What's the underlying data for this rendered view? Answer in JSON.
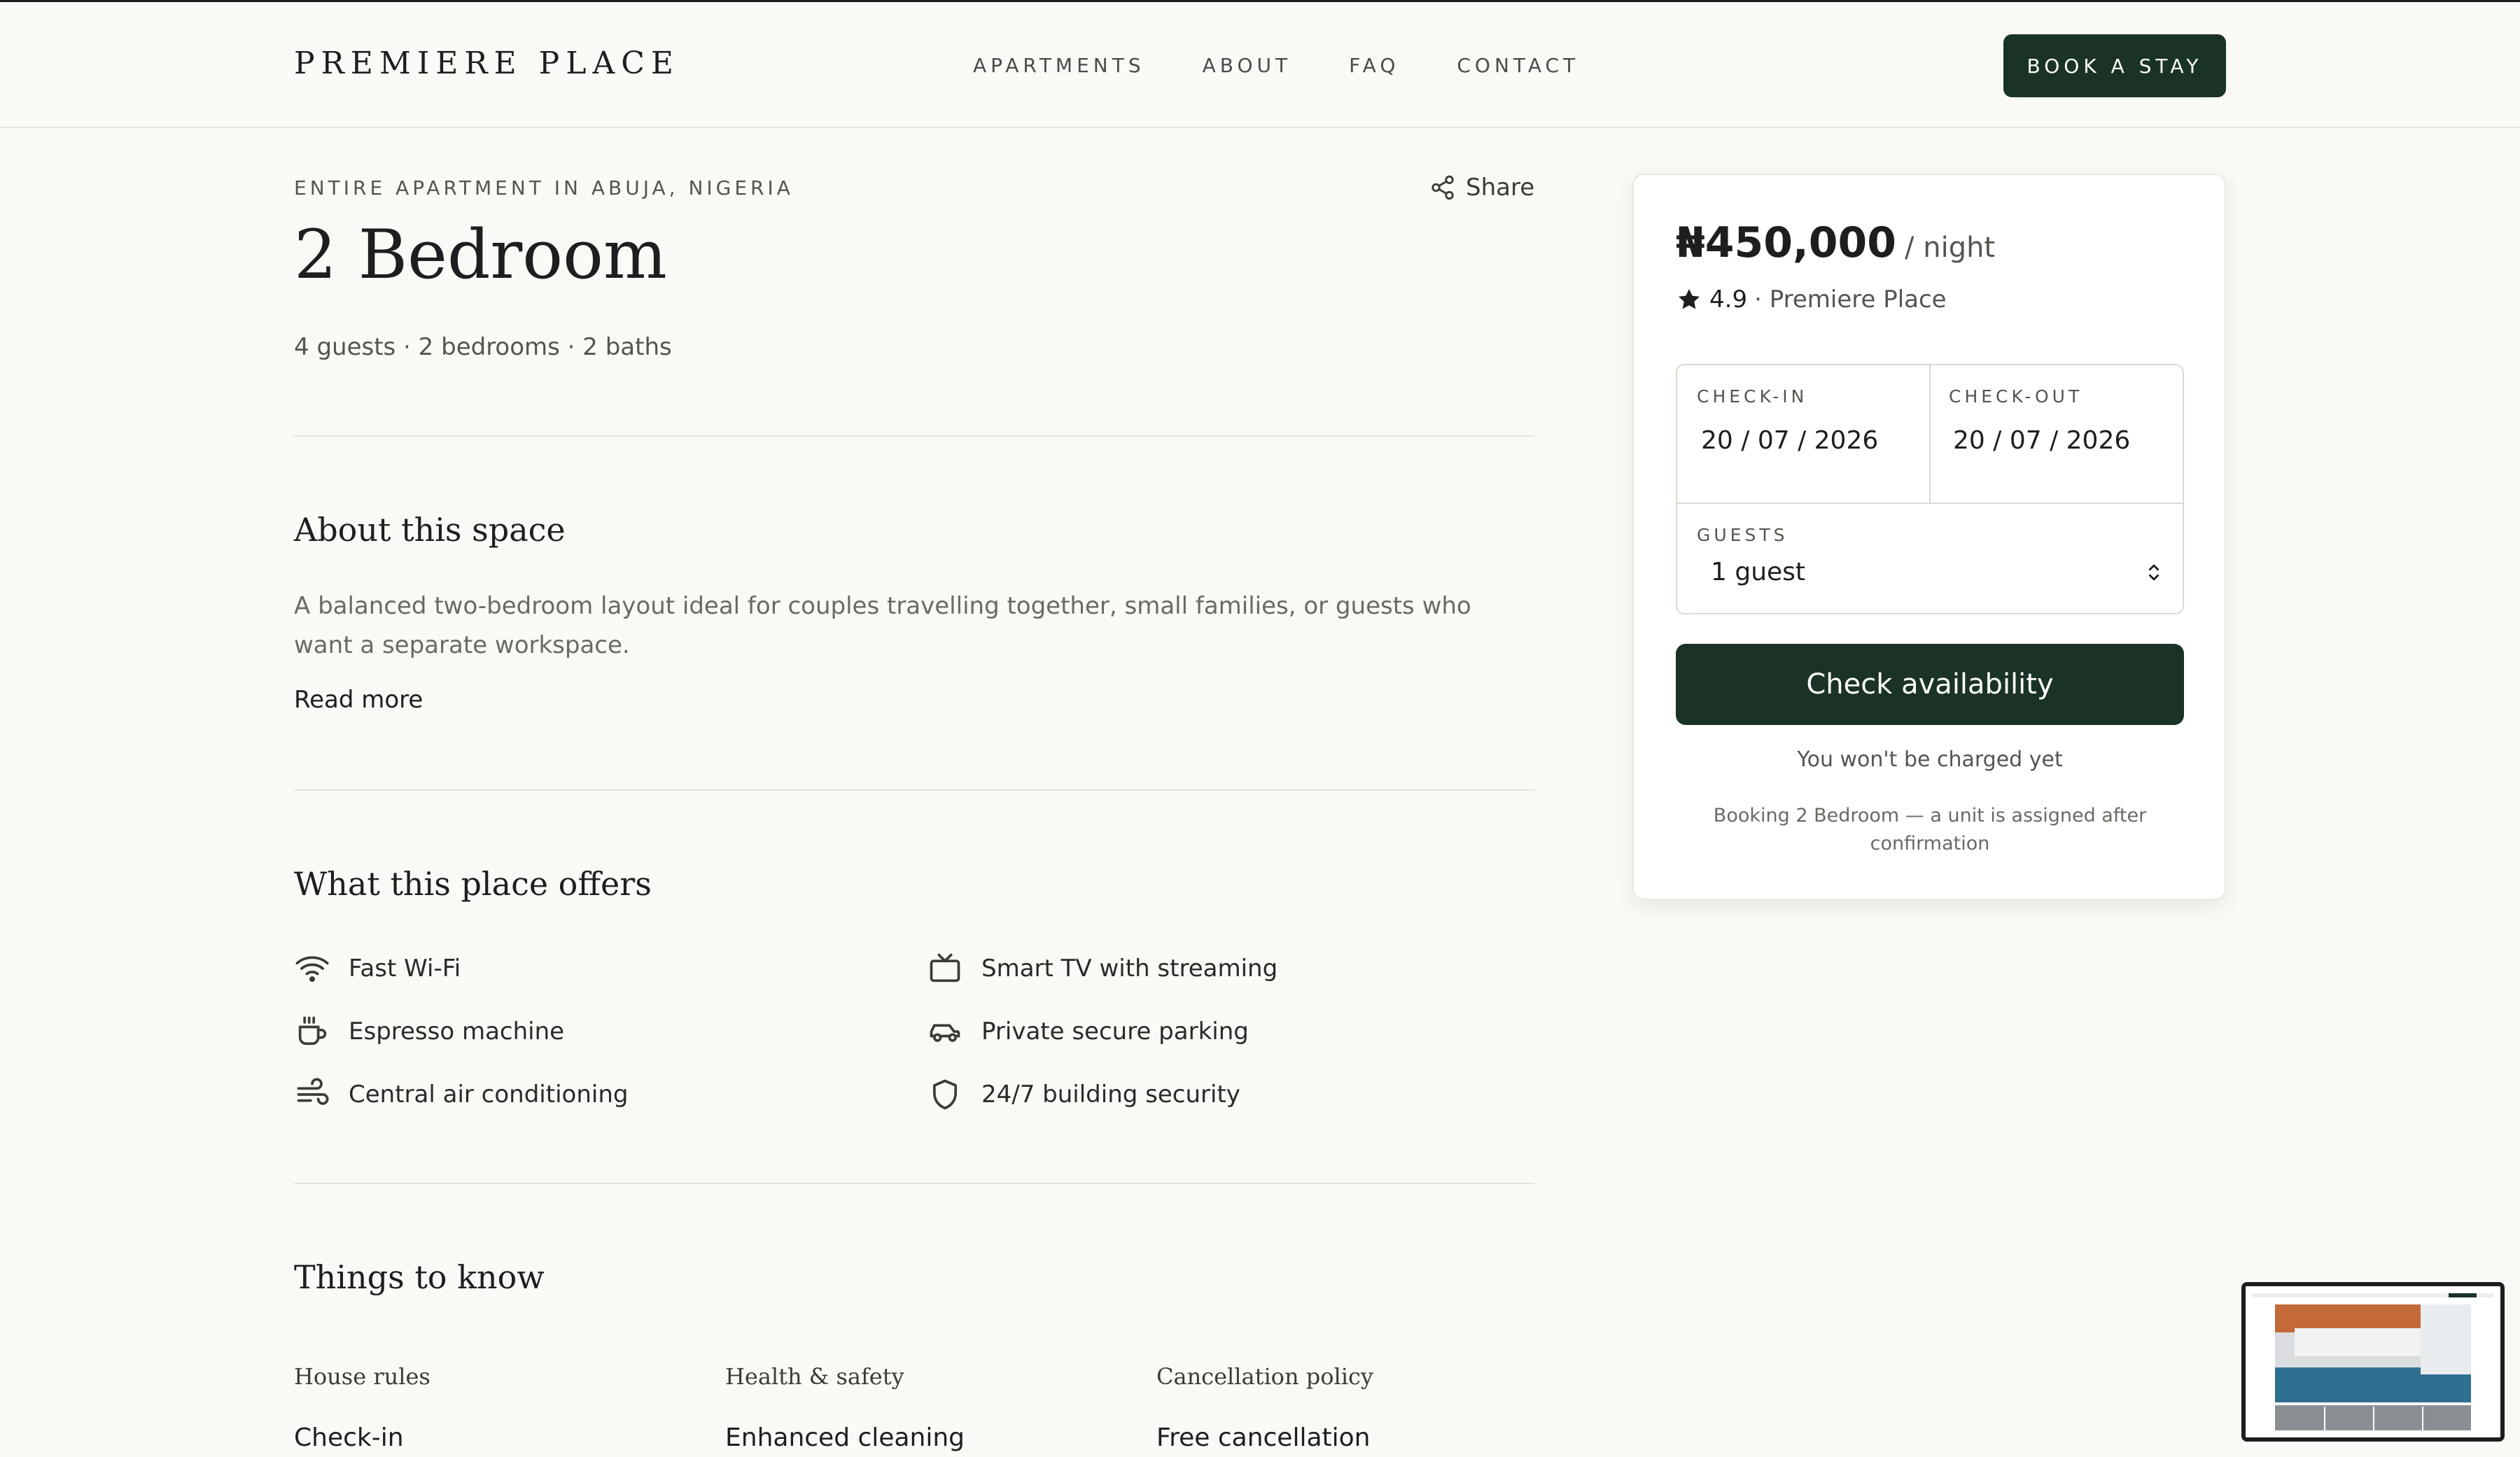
{
  "header": {
    "logo": "PREMIERE PLACE",
    "nav": [
      "APARTMENTS",
      "ABOUT",
      "FAQ",
      "CONTACT"
    ],
    "cta": "BOOK A STAY"
  },
  "listing": {
    "kicker": "ENTIRE APARTMENT IN ABUJA, NIGERIA",
    "share_label": "Share",
    "title": "2 Bedroom",
    "facts": "4 guests · 2 bedrooms · 2 baths"
  },
  "about": {
    "title": "About this space",
    "text": "A balanced two-bedroom layout ideal for couples travelling together, small families, or guests who want a separate workspace.",
    "read_more": "Read more"
  },
  "offers": {
    "title": "What this place offers",
    "items": [
      {
        "label": "Fast Wi-Fi",
        "icon": "wifi-icon"
      },
      {
        "label": "Smart TV with streaming",
        "icon": "tv-icon"
      },
      {
        "label": "Espresso machine",
        "icon": "coffee-icon"
      },
      {
        "label": "Private secure parking",
        "icon": "car-icon"
      },
      {
        "label": "Central air conditioning",
        "icon": "wind-icon"
      },
      {
        "label": "24/7 building security",
        "icon": "shield-icon"
      }
    ]
  },
  "know": {
    "title": "Things to know",
    "columns": [
      {
        "title": "House rules",
        "item": "Check-in"
      },
      {
        "title": "Health & safety",
        "item": "Enhanced cleaning"
      },
      {
        "title": "Cancellation policy",
        "item": "Free cancellation"
      }
    ]
  },
  "booking": {
    "price": "₦450,000",
    "price_unit": "/ night",
    "rating": "4.9",
    "rating_suffix": "· Premiere Place",
    "checkin_label": "CHECK-IN",
    "checkin_value": "20 / 07 / 2026",
    "checkout_label": "CHECK-OUT",
    "checkout_value": "20 / 07 / 2026",
    "guests_label": "GUESTS",
    "guests_value": "1 guest",
    "button": "Check availability",
    "note": "You won't be charged yet",
    "note_small": "Booking 2 Bedroom — a unit is assigned after confirmation"
  },
  "colors": {
    "accent": "#1b3324",
    "background": "#faf9f6"
  }
}
